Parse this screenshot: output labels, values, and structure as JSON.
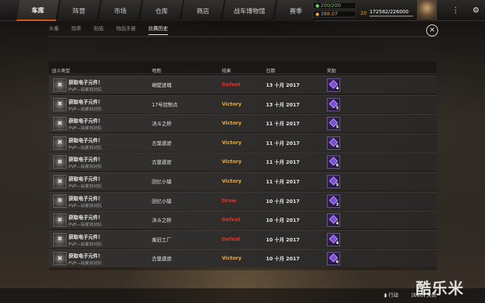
{
  "nav": {
    "tabs": [
      {
        "label": "车库",
        "active": true
      },
      {
        "label": "阵营",
        "active": false
      },
      {
        "label": "市场",
        "active": false
      },
      {
        "label": "仓库",
        "active": false
      },
      {
        "label": "商店",
        "active": false
      },
      {
        "label": "战车博物馆",
        "active": false
      },
      {
        "label": "赛季",
        "active": false
      }
    ],
    "currency": {
      "green": "200/200",
      "gold": "388.07"
    },
    "level": "20",
    "xp": "172582/226000"
  },
  "subtabs": [
    {
      "label": "头像",
      "active": false
    },
    {
      "label": "勋章",
      "active": false
    },
    {
      "label": "贴纸",
      "active": false
    },
    {
      "label": "物品手册",
      "active": false
    },
    {
      "label": "比赛历史",
      "active": true
    }
  ],
  "table": {
    "headers": {
      "type": "战斗类型",
      "map": "地图",
      "result": "结果",
      "date": "日期",
      "reward": "奖励"
    },
    "rows": [
      {
        "title": "获取电子元件！",
        "mode": "PVP—玩家间对抗",
        "map": "峭壁迷城",
        "result": "Defeat",
        "date": "13 十月 2017",
        "reward": "4"
      },
      {
        "title": "获取电子元件！",
        "mode": "PVP—玩家间对抗",
        "map": "17号控制点",
        "result": "Victory",
        "date": "13 十月 2017",
        "reward": "5"
      },
      {
        "title": "获取电子元件！",
        "mode": "PVP—玩家间对抗",
        "map": "决斗之桥",
        "result": "Victory",
        "date": "11 十月 2017",
        "reward": "5"
      },
      {
        "title": "获取电子元件！",
        "mode": "PVP—玩家间对抗",
        "map": "古堡遗迹",
        "result": "Victory",
        "date": "11 十月 2017",
        "reward": "6"
      },
      {
        "title": "获取电子元件！",
        "mode": "PVP—玩家间对抗",
        "map": "古堡遗迹",
        "result": "Victory",
        "date": "11 十月 2017",
        "reward": "6"
      },
      {
        "title": "获取电子元件！",
        "mode": "PVP—玩家间对抗",
        "map": "回忆小镇",
        "result": "Victory",
        "date": "11 十月 2017",
        "reward": "5"
      },
      {
        "title": "获取电子元件！",
        "mode": "PVP—玩家间对抗",
        "map": "回忆小镇",
        "result": "Draw",
        "date": "10 十月 2017",
        "reward": "3"
      },
      {
        "title": "获取电子元件！",
        "mode": "PVP—玩家间对抗",
        "map": "决斗之桥",
        "result": "Defeat",
        "date": "10 十月 2017",
        "reward": "4"
      },
      {
        "title": "获取电子元件！",
        "mode": "PVP—玩家间对抗",
        "map": "废旧工厂",
        "result": "Defeat",
        "date": "10 十月 2017",
        "reward": "4"
      },
      {
        "title": "获取电子元件！",
        "mode": "PVP—玩家间对抗",
        "map": "古堡遗迹",
        "result": "Victory",
        "date": "10 十月 2017",
        "reward": "6"
      }
    ]
  },
  "colors": {
    "victory": "#f0a92a",
    "defeat": "#e0342a",
    "draw": "#e0342a"
  },
  "footer": {
    "action": "行动",
    "esc_close": "[ESC] 关闭"
  },
  "watermark": "酷乐米"
}
